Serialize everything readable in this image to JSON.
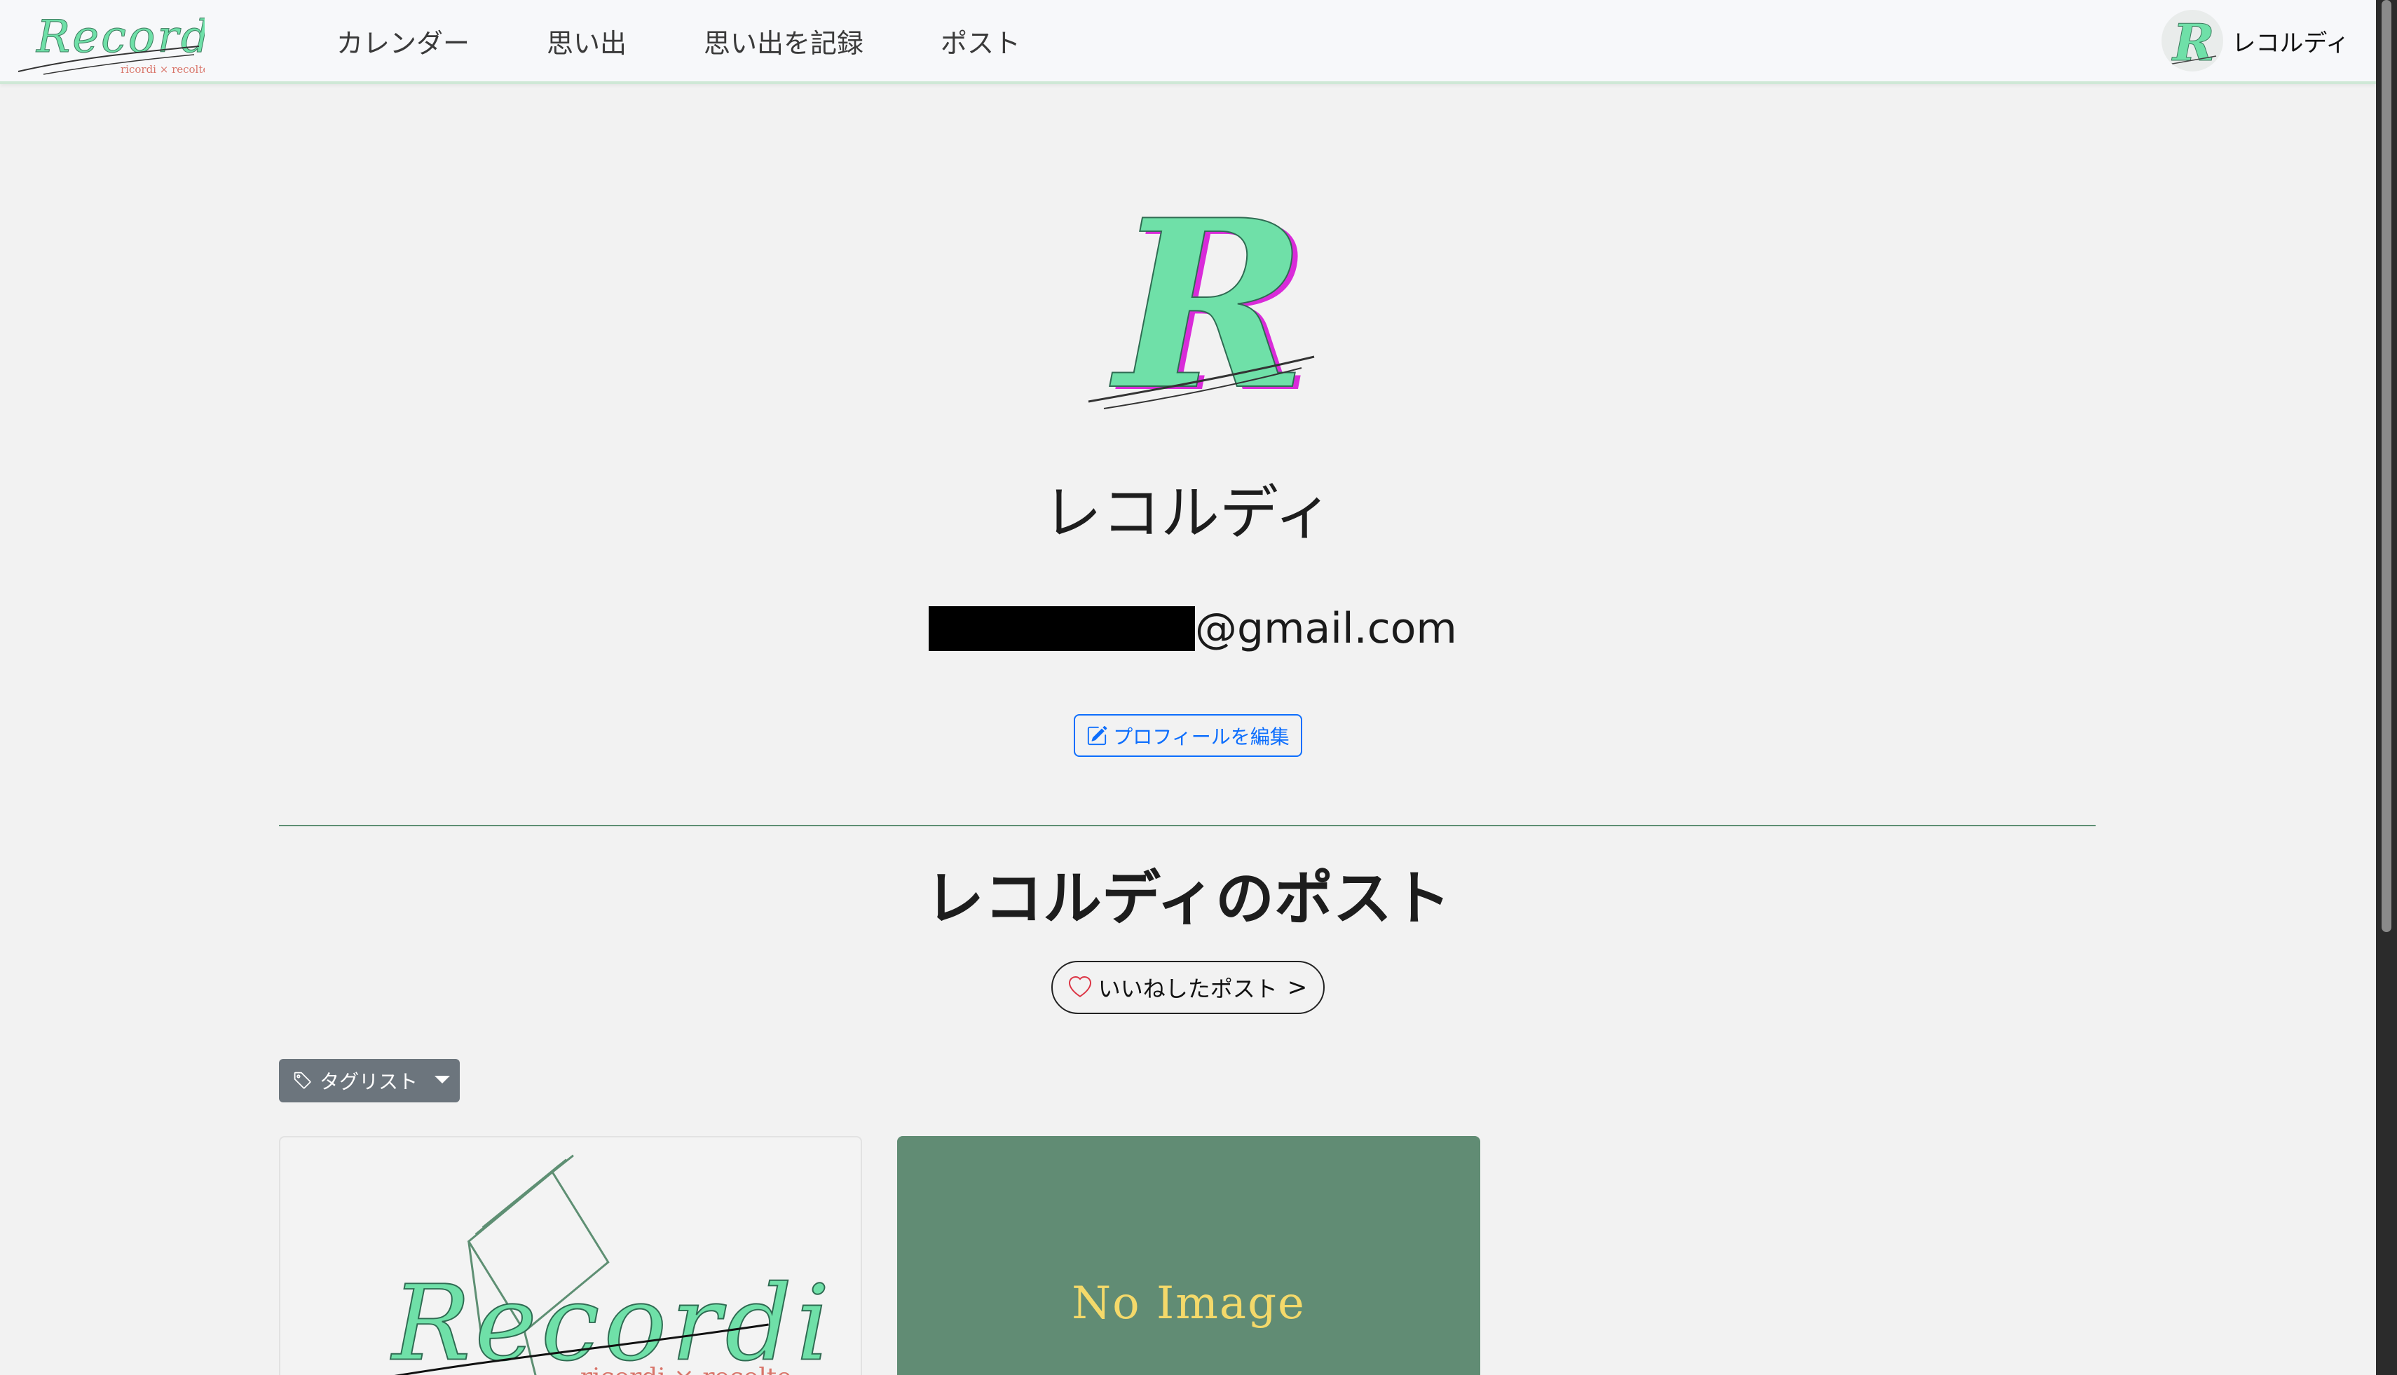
{
  "navbar": {
    "brand_text": "Recordi",
    "brand_sub": "ricordi × recolte",
    "links": [
      "カレンダー",
      "思い出",
      "思い出を記録",
      "ポスト"
    ],
    "user_name": "レコルディ"
  },
  "profile": {
    "name": "レコルディ",
    "email_suffix": "@gmail.com",
    "edit_button": "プロフィールを編集"
  },
  "posts": {
    "title": "レコルディのポスト",
    "liked_button": "いいねしたポスト",
    "liked_chevron": ">",
    "tags_button": "タグリスト",
    "cards": [
      {
        "image_text": "Recordi",
        "image_sub": "ricordi × recolte"
      },
      {
        "image_text": "No Image"
      }
    ]
  },
  "colors": {
    "brand_mint": "#6fe0a8",
    "brand_magenta": "#d92bd9",
    "divider_green": "#5e8f73",
    "card_green": "#618c74",
    "no_image_yellow": "#f4d96a",
    "primary_blue": "#0d6efd",
    "secondary_gray": "#6c757d"
  }
}
